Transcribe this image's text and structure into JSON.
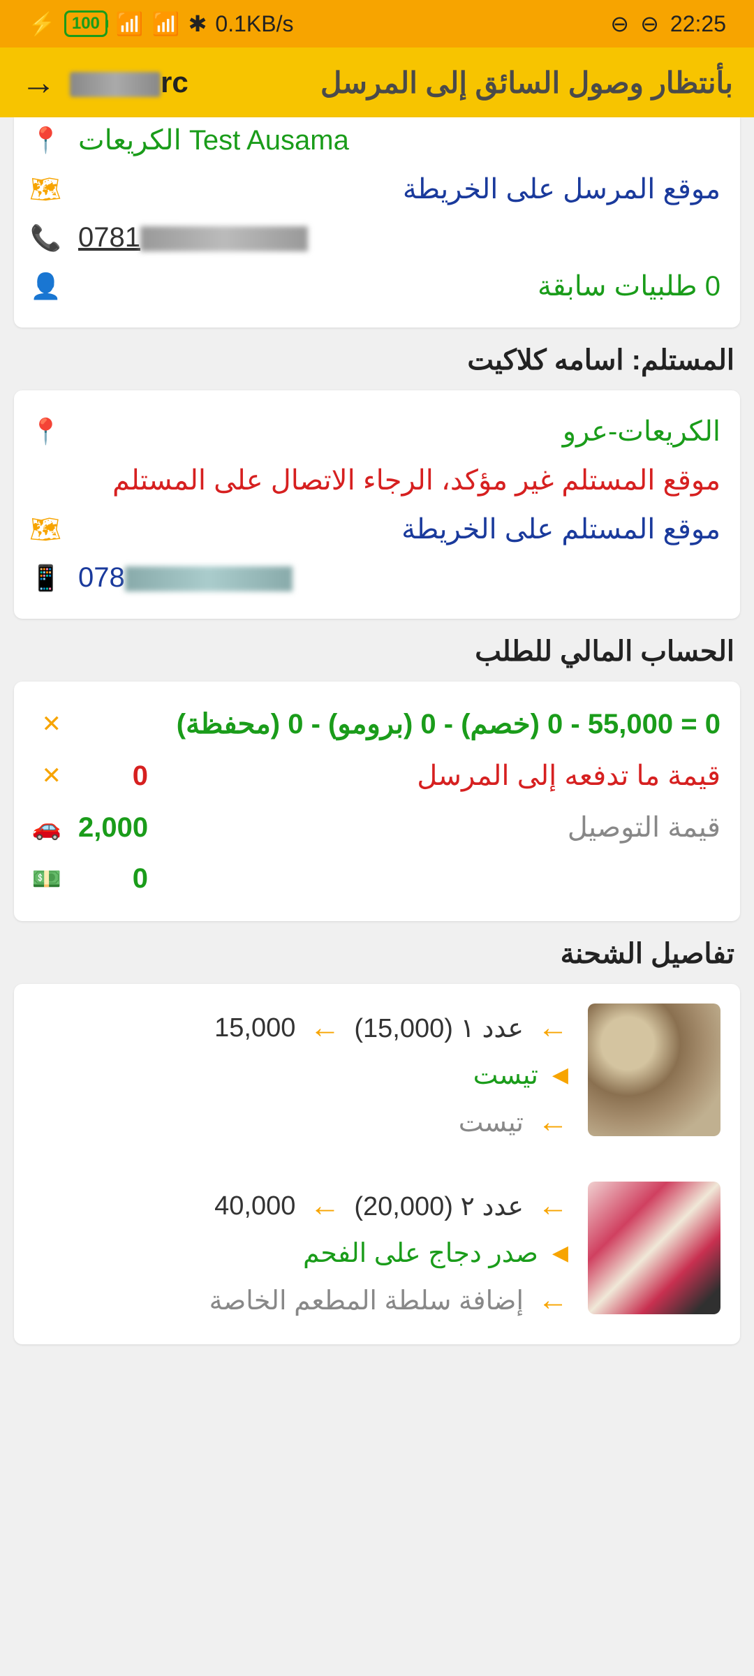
{
  "statusBar": {
    "time": "22:25",
    "dataRate": "0.1KB/s",
    "battery": "100"
  },
  "header": {
    "title": "بأنتظار وصول السائق إلى المرسل",
    "codePrefix": "rc"
  },
  "senderCard": {
    "truncatedText": "Test Ausama الكريعات",
    "mapLink": "موقع المرسل على الخريطة",
    "phonePrefix": "0781",
    "previousOrders": "0 طلبيات سابقة"
  },
  "recipient": {
    "sectionTitle": "المستلم: اسامه كلاكيت",
    "location": "الكريعات-عرو",
    "warning": "موقع المستلم غير مؤكد، الرجاء الاتصال على المستلم",
    "mapLink": "موقع المستلم على الخريطة",
    "phonePrefix": "078"
  },
  "finance": {
    "sectionTitle": "الحساب المالي للطلب",
    "calc": "0 = 55,000 - 0 (خصم) - 0 (برومو) - 0 (محفظة)",
    "payToSenderValue": "0",
    "payToSenderLabel": "قيمة ما تدفعه إلى المرسل",
    "deliveryValue": "2,000",
    "deliveryLabel": "قيمة التوصيل",
    "cashValue": "0"
  },
  "shipment": {
    "sectionTitle": "تفاصيل الشحنة",
    "items": [
      {
        "qtyPrice": "عدد ١ (15,000)",
        "total": "15,000",
        "nameGreen": "تيست",
        "nameGray": "تيست"
      },
      {
        "qtyPrice": "عدد ٢ (20,000)",
        "total": "40,000",
        "nameGreen": "صدر دجاج على الفحم",
        "nameGray": "إضافة سلطة المطعم الخاصة"
      }
    ]
  }
}
